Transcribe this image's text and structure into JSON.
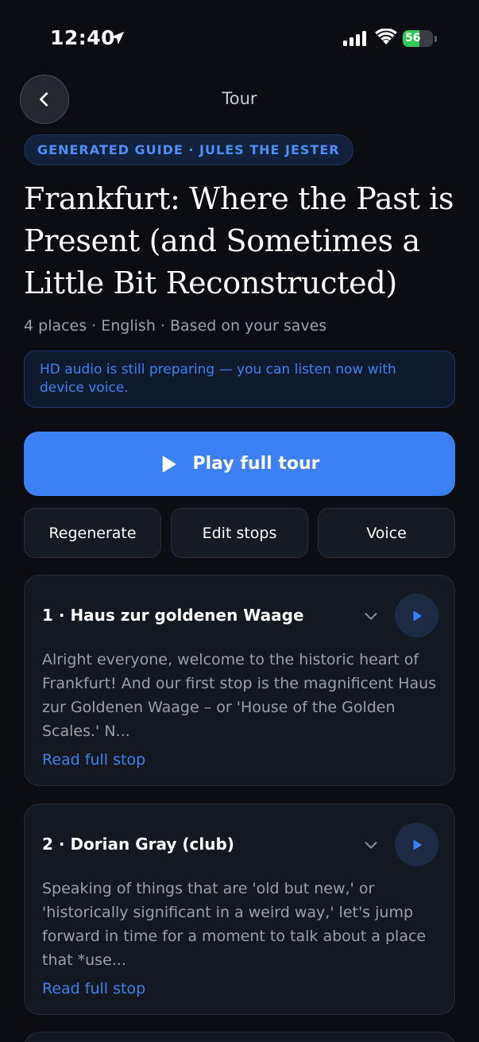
{
  "status_bar": {
    "time": "12:40",
    "battery_percent": "56",
    "battery_level": 0.56
  },
  "nav": {
    "title": "Tour"
  },
  "guide": {
    "tag": "GENERATED GUIDE · JULES THE JESTER",
    "title": "Frankfurt: Where the Past is Present (and Sometimes a Little Bit Reconstructed)",
    "meta": "4 places · English · Based on your saves",
    "notice": "HD audio is still preparing — you can listen now with device voice."
  },
  "actions": {
    "play_full_tour": "Play full tour",
    "regenerate": "Regenerate",
    "edit_stops": "Edit stops",
    "voice": "Voice"
  },
  "stops": [
    {
      "title": "1 · Haus zur goldenen Waage",
      "excerpt": "Alright everyone, welcome to the historic heart of Frankfurt! And our first stop is the magnificent Haus zur Goldenen Waage – or 'House of the Golden Scales.' N...",
      "link": "Read full stop"
    },
    {
      "title": "2 · Dorian Gray (club)",
      "excerpt": "Speaking of things that are 'old but new,' or 'historically significant in a weird way,' let's jump forward in time for a moment to talk about a place that *use...",
      "link": "Read full stop"
    }
  ],
  "colors": {
    "accent": "#3d7ff4",
    "background": "#0b0d12",
    "card": "#131821",
    "link": "#3f82ee"
  }
}
